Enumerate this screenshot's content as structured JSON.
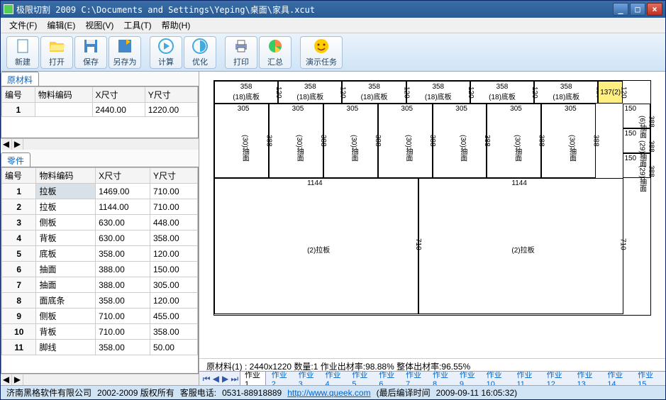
{
  "window": {
    "title": "极限切割 2009 C:\\Documents and Settings\\Yeping\\桌面\\家具.xcut"
  },
  "menu": {
    "file": "文件(F)",
    "edit": "编辑(E)",
    "view": "视图(V)",
    "tools": "工具(T)",
    "help": "帮助(H)"
  },
  "toolbar": {
    "new": "新建",
    "open": "打开",
    "save": "保存",
    "saveas": "另存为",
    "calc": "计算",
    "optimize": "优化",
    "print": "打印",
    "summary": "汇总",
    "demo": "演示任务"
  },
  "rawmat": {
    "title": "原材料",
    "headers": {
      "id": "编号",
      "code": "物料编码",
      "x": "X尺寸",
      "y": "Y尺寸"
    },
    "rows": [
      {
        "id": "1",
        "code": "",
        "x": "2440.00",
        "y": "1220.00"
      }
    ]
  },
  "parts": {
    "title": "零件",
    "headers": {
      "id": "编号",
      "code": "物料编码",
      "x": "X尺寸",
      "y": "Y尺寸"
    },
    "rows": [
      {
        "id": "1",
        "code": "拉板",
        "x": "1469.00",
        "y": "710.00"
      },
      {
        "id": "2",
        "code": "拉板",
        "x": "1144.00",
        "y": "710.00"
      },
      {
        "id": "3",
        "code": "侧板",
        "x": "630.00",
        "y": "448.00"
      },
      {
        "id": "4",
        "code": "背板",
        "x": "630.00",
        "y": "358.00"
      },
      {
        "id": "5",
        "code": "底板",
        "x": "358.00",
        "y": "120.00"
      },
      {
        "id": "6",
        "code": "抽面",
        "x": "388.00",
        "y": "150.00"
      },
      {
        "id": "7",
        "code": "抽面",
        "x": "388.00",
        "y": "305.00"
      },
      {
        "id": "8",
        "code": "面底条",
        "x": "358.00",
        "y": "120.00"
      },
      {
        "id": "9",
        "code": "侧板",
        "x": "710.00",
        "y": "455.00"
      },
      {
        "id": "10",
        "code": "背板",
        "x": "710.00",
        "y": "358.00"
      },
      {
        "id": "11",
        "code": "脚线",
        "x": "358.00",
        "y": "50.00"
      }
    ]
  },
  "layout": {
    "top_row": [
      {
        "w": "358",
        "sub": "(18)底板",
        "side": "120"
      },
      {
        "w": "358",
        "sub": "(18)底板",
        "side": "120"
      },
      {
        "w": "358",
        "sub": "(18)底板",
        "side": "120"
      },
      {
        "w": "358",
        "sub": "(18)底板",
        "side": "120"
      },
      {
        "w": "358",
        "sub": "(18)底板",
        "side": "120"
      },
      {
        "w": "358",
        "sub": "(18)底板",
        "side": "120"
      }
    ],
    "top_right": {
      "w": "137",
      "sub": "(2)",
      "side": "120"
    },
    "mid_row": [
      {
        "w": "305",
        "sub": "(30)抽面",
        "side": "388"
      },
      {
        "w": "305",
        "sub": "(30)抽面",
        "side": "388"
      },
      {
        "w": "305",
        "sub": "(30)抽面",
        "side": "388"
      },
      {
        "w": "305",
        "sub": "(30)抽面",
        "side": "388"
      },
      {
        "w": "305",
        "sub": "(30)抽面",
        "side": "388"
      },
      {
        "w": "305",
        "sub": "(30)抽面",
        "side": "388"
      },
      {
        "w": "305",
        "sub": "(30)抽面",
        "side": "388"
      }
    ],
    "right_col": [
      {
        "h": "150",
        "sub": "(6)抽面",
        "side": "388"
      },
      {
        "h": "150",
        "sub": "(29)抽面",
        "side": "388"
      },
      {
        "h": "150",
        "sub": "(29)抽面",
        "side": "388"
      }
    ],
    "bottom_left": {
      "w": "1144",
      "sub": "(2)拉板",
      "side": "710"
    },
    "bottom_right": {
      "w": "1144",
      "sub": "(2)拉板",
      "side": "710"
    }
  },
  "info": "原材料(1) :  2440x1220  数量:1  作业出材率:98.88%  整体出材率:96.55%",
  "tabs": [
    "作业1",
    "作业2",
    "作业3",
    "作业4",
    "作业5",
    "作业6",
    "作业7",
    "作业8",
    "作业9",
    "作业10",
    "作业11",
    "作业12",
    "作业13",
    "作业14",
    "作业15"
  ],
  "status": {
    "company": "济南黑格软件有限公司",
    "copyright": "2002-2009 版权所有",
    "phone_label": "客服电话:",
    "phone": "0531-88918889",
    "url": "http://www.queek.com",
    "build_label": "(最后编译时间",
    "build_time": "2009-09-11 16:05:32)"
  }
}
